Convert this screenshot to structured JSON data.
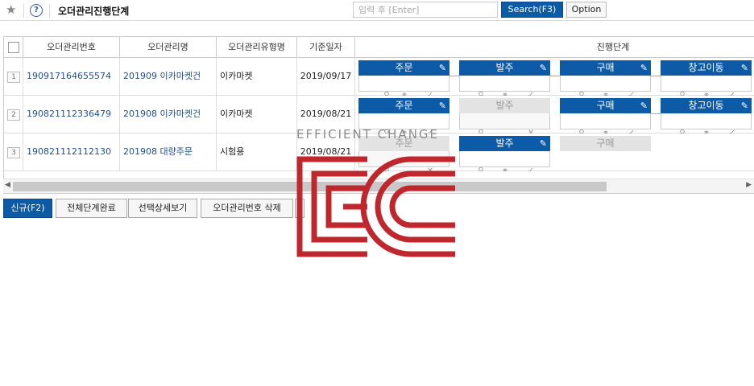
{
  "toolbar": {
    "page_title": "오더관리진행단계",
    "search_placeholder": "입력 후 [Enter]",
    "search_label": "Search(F3)",
    "option_label": "Option"
  },
  "grid": {
    "headers": {
      "order_no": "오더관리번호",
      "order_name": "오더관리명",
      "order_type": "오더관리유형명",
      "base_date": "기준일자",
      "progress": "진행단계"
    },
    "rows": [
      {
        "num": "1",
        "order_no": "190917164655574",
        "order_name": "201909 이카마켓건",
        "order_type": "이카마켓",
        "base_date": "2019/09/17",
        "stages": [
          "주문",
          "발주",
          "구매",
          "창고이동"
        ]
      },
      {
        "num": "2",
        "order_no": "190821112336479",
        "order_name": "201908 이카마켓건",
        "order_type": "이카마켓",
        "base_date": "2019/08/21",
        "stages": [
          "주문",
          "발주",
          "구매",
          "창고이동"
        ]
      },
      {
        "num": "3",
        "order_no": "190821112112130",
        "order_name": "201908 대량주문",
        "order_type": "시험용",
        "base_date": "2019/08/21",
        "stages": [
          "주문",
          "발주",
          "구매"
        ]
      }
    ]
  },
  "icons": {
    "edit": "pencil-icon",
    "view": "search-icon",
    "link": "link-icon",
    "done": "check-icon",
    "delete": "x-icon"
  },
  "footer": {
    "new_label": "신규(F2)",
    "complete_all_label": "전체단계완료",
    "detail_label": "선택상세보기",
    "delete_label": "오더관리번호 삭제"
  },
  "watermark": {
    "text": "EFFICIENT CHANGE",
    "logo": "EC"
  },
  "colors": {
    "accent": "#0d5aa7",
    "link": "#1f4f8f",
    "disabled": "#e3e3e3",
    "logo_red": "#c0272d"
  }
}
